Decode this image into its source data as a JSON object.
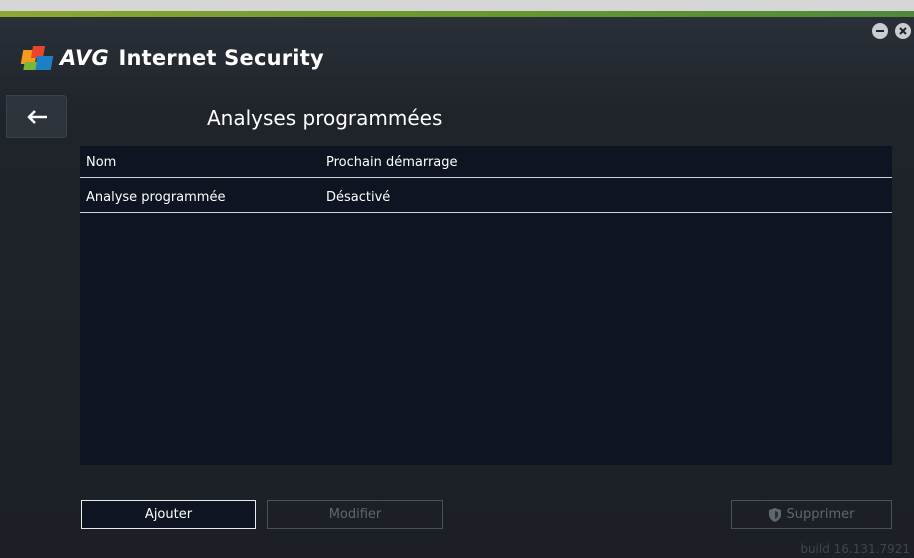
{
  "app": {
    "brand": "AVG",
    "product": "Internet Security",
    "minimize_icon": "minimize-icon",
    "close_icon": "close-icon",
    "back_icon": "arrow-left-icon"
  },
  "page": {
    "title": "Analyses programmées"
  },
  "table": {
    "columns": [
      "Nom",
      "Prochain démarrage"
    ],
    "rows": [
      [
        "Analyse programmée",
        "Désactivé"
      ]
    ]
  },
  "buttons": {
    "add": "Ajouter",
    "modify": "Modifier",
    "delete": "Supprimer",
    "delete_icon": "shield-icon"
  },
  "footer": {
    "build": "build 16.131.7921"
  },
  "colors": {
    "accent_green": "#8ea834",
    "window_bg": "#1e2329",
    "table_bg": "#0e1421",
    "disabled_text": "#5e6670"
  }
}
